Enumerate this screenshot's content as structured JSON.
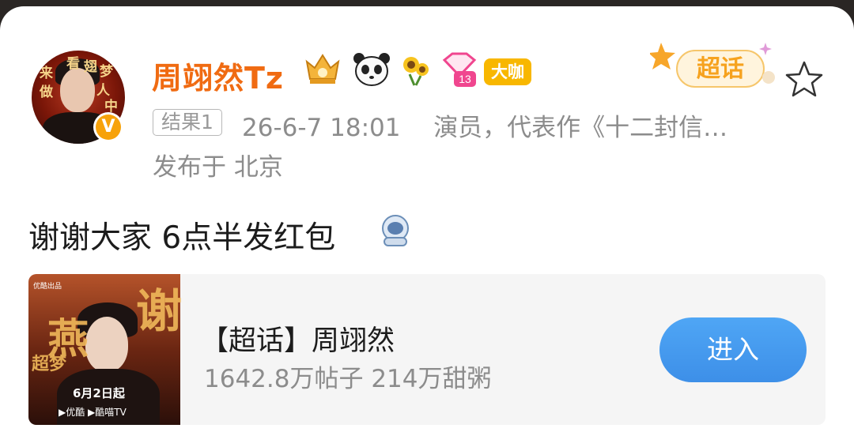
{
  "user": {
    "name": "周翊然Tz",
    "avatar_text": [
      "来",
      "看",
      "翅",
      "梦",
      "做",
      "人",
      "中"
    ],
    "verified_badge": "V",
    "badges": [
      "crown-icon",
      "panda-icon",
      "sunflower-icon",
      "diamond-icon"
    ],
    "diamond_level": "13",
    "daka_label": "大咖",
    "chaohua_label": "超话"
  },
  "meta": {
    "tag": "结果1",
    "timestamp": "26-6-7 18:01",
    "description": "演员，代表作《十二封信…",
    "location": "发布于 北京"
  },
  "post": {
    "text": "谢谢大家 6点半发红包"
  },
  "supertopic": {
    "title": "【超话】周翊然",
    "stats": "1642.8万帖子 214万甜粥",
    "button": "进入",
    "poster": {
      "corner_label": "优酷出品",
      "calligraphy_1": "谢",
      "calligraphy_2": "燕",
      "calligraphy_3": "超梦",
      "date": "6月2日起",
      "platforms": "▶优酷 ▶酷喵TV"
    }
  },
  "colors": {
    "username": "#f06b12",
    "accent_blue": "#3d8fe8",
    "daka_bg": "#f8b700"
  }
}
